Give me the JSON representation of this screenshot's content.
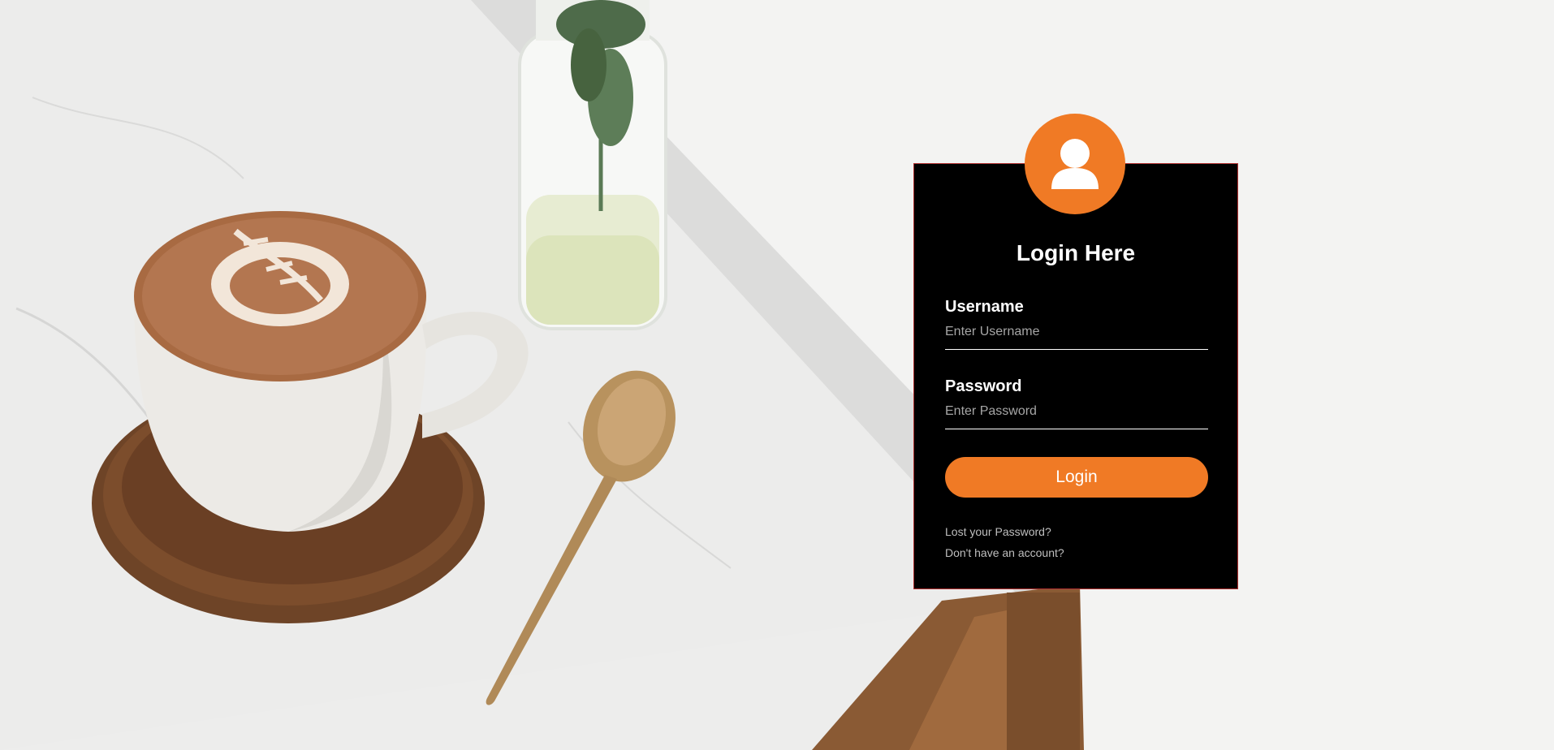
{
  "login": {
    "title": "Login Here",
    "username_label": "Username",
    "username_placeholder": "Enter Username",
    "password_label": "Password",
    "password_placeholder": "Enter Password",
    "button_label": "Login",
    "lost_password_link": "Lost your Password?",
    "no_account_link": "Don't have an account?",
    "avatar_icon": "user-icon"
  },
  "colors": {
    "accent": "#f07a25",
    "card_background": "#000000",
    "card_border": "#b03030"
  }
}
